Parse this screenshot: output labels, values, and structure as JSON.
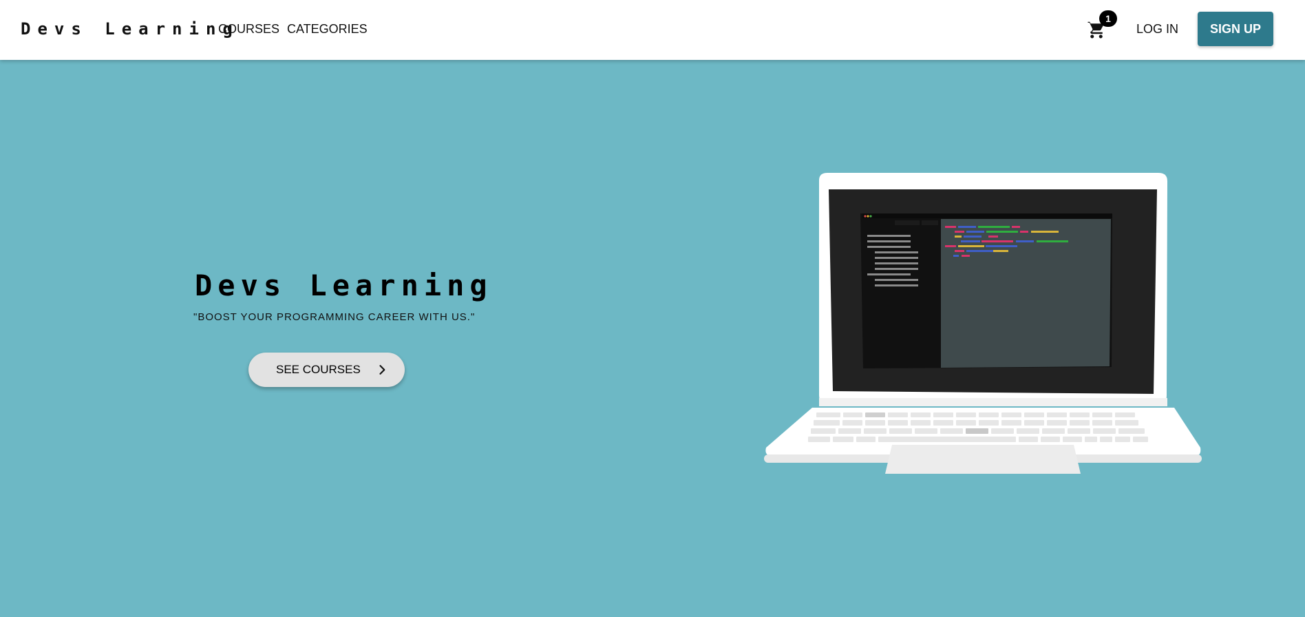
{
  "header": {
    "brand": "Devs Learning",
    "nav": [
      {
        "label": "COURSES"
      },
      {
        "label": "CATEGORIES"
      }
    ],
    "cart": {
      "icon": "shopping-cart-icon",
      "count": "1"
    },
    "login_label": "LOG IN",
    "signup_label": "SIGN UP"
  },
  "hero": {
    "title": "Devs Learning",
    "tagline": "\"BOOST YOUR PROGRAMMING CAREER WITH US.\"",
    "cta_label": "SEE COURSES",
    "cta_icon": "chevron-right-icon",
    "illustration": "laptop-illustration"
  },
  "colors": {
    "background": "#6db8c5",
    "header_bg": "#ffffff",
    "signup_bg": "#2e7a8c",
    "cta_bg": "#e2e2e2"
  }
}
